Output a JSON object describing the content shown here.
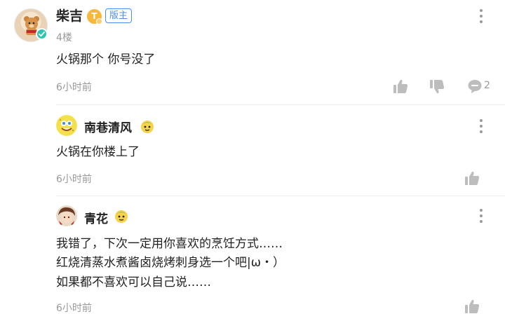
{
  "post": {
    "author": "柴吉",
    "level_badge": "T",
    "owner_tag": "版主",
    "floor": "4楼",
    "content": "火锅那个 你号没了",
    "time": "6小时前",
    "comment_count": "2"
  },
  "replies": [
    {
      "author": "南巷清风",
      "content": "火锅在你楼上了",
      "time": "6小时前"
    },
    {
      "author": "青花",
      "content_lines": [
        "我错了，下次一定用你喜欢的烹饪方式……",
        "红烧清蒸水煮酱卤烧烤刺身选一个吧|ω・）",
        "如果都不喜欢可以自己说……"
      ],
      "time": "6小时前"
    }
  ],
  "icons": [
    "more-vertical-icon",
    "thumb-up-icon",
    "thumb-down-icon",
    "comment-bubble-icon",
    "verified-check-icon"
  ],
  "colors": {
    "accent_blue": "#4a8ef0",
    "level_orange": "#f6b83c",
    "verify_teal": "#2fc4b0",
    "muted_text": "#999999"
  }
}
